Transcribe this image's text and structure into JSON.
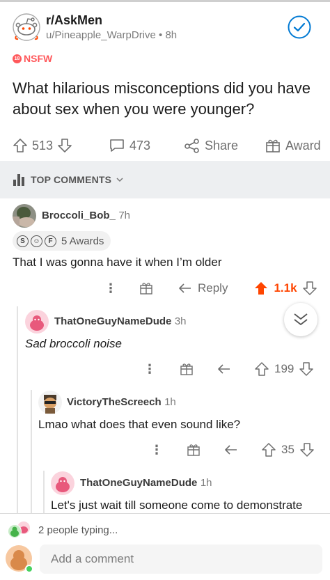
{
  "post": {
    "subreddit": "r/AskMen",
    "author": "u/Pineapple_WarpDrive",
    "age": "8h",
    "nsfw_badge": "18",
    "nsfw_label": "NSFW",
    "title": "What hilarious misconceptions did you have about sex when you were younger?",
    "upvotes": "513",
    "comments": "473",
    "share_label": "Share",
    "award_label": "Award"
  },
  "sort": {
    "label": "TOP COMMENTS"
  },
  "comments": [
    {
      "user": "Broccoli_Bob_",
      "time": "7h",
      "awards_label": "5 Awards",
      "award_icons": [
        "S",
        "☺",
        "F"
      ],
      "text": "That I was gonna have it when I’m older",
      "reply_label": "Reply",
      "score": "1.1k",
      "score_color": "#ff4500"
    },
    {
      "user": "ThatOneGuyNameDude",
      "time": "3h",
      "text": "Sad broccoli noise",
      "score": "199"
    },
    {
      "user": "VictoryTheScreech",
      "time": "1h",
      "text": "Lmao what does that even sound like?",
      "score": "35"
    },
    {
      "user": "ThatOneGuyNameDude",
      "time": "1h",
      "text": "Let's just wait till someone come to demonstrate"
    }
  ],
  "footer": {
    "typing": "2 people typing...",
    "placeholder": "Add a comment"
  },
  "colors": {
    "accent": "#ff4500",
    "nsfw": "#ff585b",
    "join": "#0079d3"
  }
}
